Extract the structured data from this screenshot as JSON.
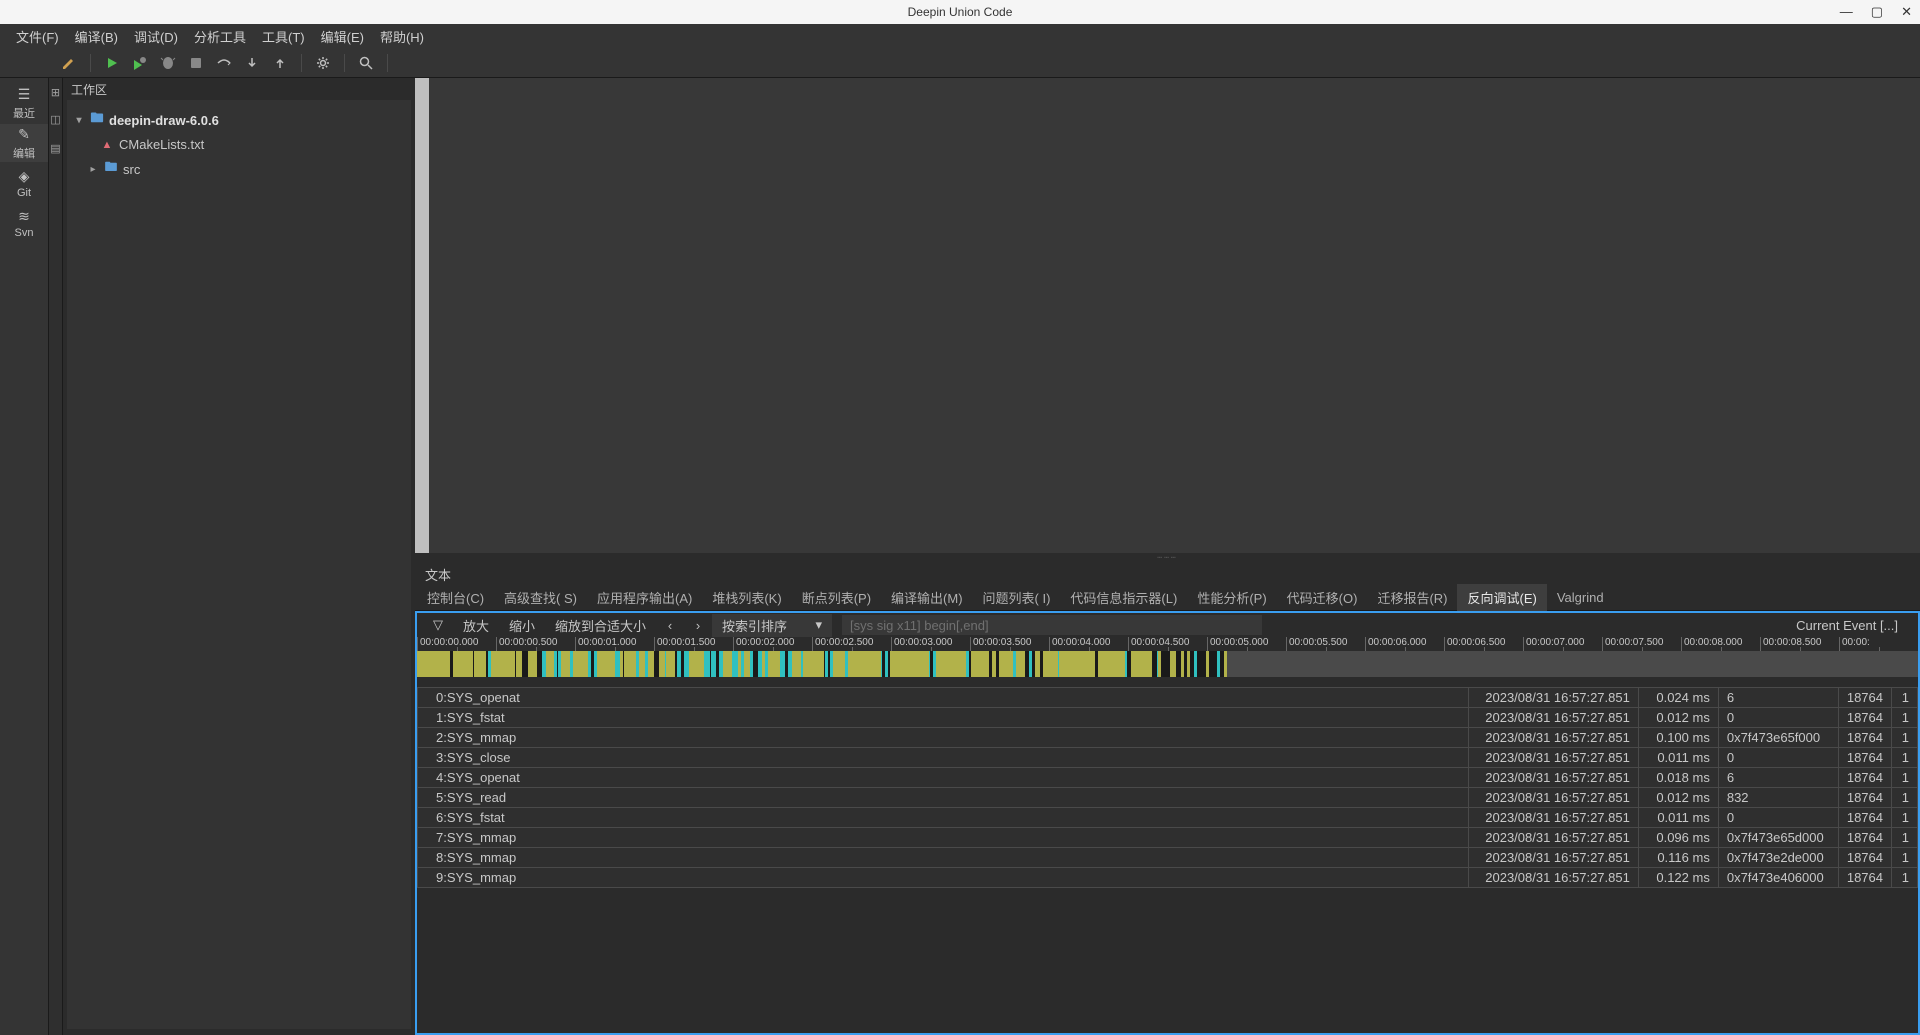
{
  "title": "Deepin Union Code",
  "menubar": [
    "文件(F)",
    "编译(B)",
    "调试(D)",
    "分析工具",
    "工具(T)",
    "编辑(E)",
    "帮助(H)"
  ],
  "sidebar": {
    "items": [
      {
        "label": "最近",
        "icon": "☰"
      },
      {
        "label": "编辑",
        "icon": "✎",
        "active": true
      },
      {
        "label": "Git",
        "icon": "◈"
      },
      {
        "label": "Svn",
        "icon": "≋"
      }
    ]
  },
  "workspace": {
    "title": "工作区",
    "root": "deepin-draw-6.0.6",
    "files": [
      {
        "name": "CMakeLists.txt",
        "icon": "▲",
        "type": "file"
      },
      {
        "name": "src",
        "icon": "folder",
        "type": "folder"
      }
    ]
  },
  "bottom_label": "文本",
  "bottom_tabs": [
    {
      "label": "控制台(C)"
    },
    {
      "label": "高级查找( S)"
    },
    {
      "label": "应用程序输出(A)"
    },
    {
      "label": "堆栈列表(K)"
    },
    {
      "label": "断点列表(P)"
    },
    {
      "label": "编译输出(M)"
    },
    {
      "label": "问题列表( I)"
    },
    {
      "label": "代码信息指示器(L)"
    },
    {
      "label": "性能分析(P)"
    },
    {
      "label": "代码迁移(O)"
    },
    {
      "label": "迁移报告(R)"
    },
    {
      "label": "反向调试(E)",
      "active": true
    },
    {
      "label": "Valgrind"
    }
  ],
  "rdebug": {
    "tools": [
      "放大",
      "缩小",
      "缩放到合适大小"
    ],
    "sort": "按索引排序",
    "search_placeholder": "[sys sig x11] begin[,end]",
    "current_label": "Current Event [...]",
    "filter_icon": "▽"
  },
  "timeline_ticks": [
    "00:00:00.000",
    "00:00:00.500",
    "00:00:01.000",
    "00:00:01.500",
    "00:00:02.000",
    "00:00:02.500",
    "00:00:03.000",
    "00:00:03.500",
    "00:00:04.000",
    "00:00:04.500",
    "00:00:05.000",
    "00:00:05.500",
    "00:00:06.000",
    "00:00:06.500",
    "00:00:07.000",
    "00:00:07.500",
    "00:00:08.000",
    "00:00:08.500",
    "00:00:"
  ],
  "events": [
    {
      "name": "0:SYS_openat",
      "time": "2023/08/31 16:57:27.851",
      "dur": "0.024 ms",
      "ret": "6",
      "pid": "18764",
      "n": "1"
    },
    {
      "name": "1:SYS_fstat",
      "time": "2023/08/31 16:57:27.851",
      "dur": "0.012 ms",
      "ret": "0",
      "pid": "18764",
      "n": "1"
    },
    {
      "name": "2:SYS_mmap",
      "time": "2023/08/31 16:57:27.851",
      "dur": "0.100 ms",
      "ret": "0x7f473e65f000",
      "pid": "18764",
      "n": "1"
    },
    {
      "name": "3:SYS_close",
      "time": "2023/08/31 16:57:27.851",
      "dur": "0.011 ms",
      "ret": "0",
      "pid": "18764",
      "n": "1"
    },
    {
      "name": "4:SYS_openat",
      "time": "2023/08/31 16:57:27.851",
      "dur": "0.018 ms",
      "ret": "6",
      "pid": "18764",
      "n": "1"
    },
    {
      "name": "5:SYS_read",
      "time": "2023/08/31 16:57:27.851",
      "dur": "0.012 ms",
      "ret": "832",
      "pid": "18764",
      "n": "1"
    },
    {
      "name": "6:SYS_fstat",
      "time": "2023/08/31 16:57:27.851",
      "dur": "0.011 ms",
      "ret": "0",
      "pid": "18764",
      "n": "1"
    },
    {
      "name": "7:SYS_mmap",
      "time": "2023/08/31 16:57:27.851",
      "dur": "0.096 ms",
      "ret": "0x7f473e65d000",
      "pid": "18764",
      "n": "1"
    },
    {
      "name": "8:SYS_mmap",
      "time": "2023/08/31 16:57:27.851",
      "dur": "0.116 ms",
      "ret": "0x7f473e2de000",
      "pid": "18764",
      "n": "1"
    },
    {
      "name": "9:SYS_mmap",
      "time": "2023/08/31 16:57:27.851",
      "dur": "0.122 ms",
      "ret": "0x7f473e406000",
      "pid": "18764",
      "n": "1"
    }
  ],
  "timeline_segments": [
    {
      "w": 2.2,
      "c": "#b2b24a"
    },
    {
      "w": 0.2,
      "c": "#1a1a1a"
    },
    {
      "w": 1.3,
      "c": "#b2b24a"
    },
    {
      "w": 0.1,
      "c": "#1a1a1a"
    },
    {
      "w": 0.8,
      "c": "#b2b24a"
    },
    {
      "w": 0.1,
      "c": "#1a1a1a"
    },
    {
      "w": 0.2,
      "c": "#30c0c0"
    },
    {
      "w": 1.6,
      "c": "#b2b24a"
    },
    {
      "w": 0.1,
      "c": "#1a1a1a"
    },
    {
      "w": 0.4,
      "c": "#b2b24a"
    },
    {
      "w": 0.4,
      "c": "#1a1a1a"
    },
    {
      "w": 0.6,
      "c": "#b2b24a"
    },
    {
      "w": 0.3,
      "c": "#1a1a1a"
    },
    {
      "w": 0.3,
      "c": "#30c0c0"
    },
    {
      "w": 0.5,
      "c": "#b2b24a"
    },
    {
      "w": 0.2,
      "c": "#30c0c0"
    },
    {
      "w": 0.1,
      "c": "#1a1a1a"
    },
    {
      "w": 0.2,
      "c": "#30c0c0"
    },
    {
      "w": 0.6,
      "c": "#b2b24a"
    },
    {
      "w": 0.2,
      "c": "#30c0c0"
    },
    {
      "w": 1.0,
      "c": "#b2b24a"
    },
    {
      "w": 0.2,
      "c": "#30c0c0"
    },
    {
      "w": 0.2,
      "c": "#1a1a1a"
    },
    {
      "w": 0.2,
      "c": "#30c0c0"
    },
    {
      "w": 1.2,
      "c": "#b2b24a"
    },
    {
      "w": 0.3,
      "c": "#30c0c0"
    },
    {
      "w": 0.2,
      "c": "#b2b24a"
    },
    {
      "w": 0.1,
      "c": "#1a1a1a"
    },
    {
      "w": 0.8,
      "c": "#b2b24a"
    },
    {
      "w": 0.2,
      "c": "#30c0c0"
    },
    {
      "w": 0.4,
      "c": "#b2b24a"
    },
    {
      "w": 0.2,
      "c": "#30c0c0"
    },
    {
      "w": 0.4,
      "c": "#b2b24a"
    },
    {
      "w": 0.3,
      "c": "#1a1a1a"
    },
    {
      "w": 0.4,
      "c": "#b2b24a"
    },
    {
      "w": 0.1,
      "c": "#30c0c0"
    },
    {
      "w": 0.6,
      "c": "#b2b24a"
    },
    {
      "w": 0.1,
      "c": "#1a1a1a"
    },
    {
      "w": 0.3,
      "c": "#30c0c0"
    },
    {
      "w": 0.2,
      "c": "#1a1a1a"
    },
    {
      "w": 0.3,
      "c": "#30c0c0"
    },
    {
      "w": 1.0,
      "c": "#b2b24a"
    },
    {
      "w": 0.4,
      "c": "#30c0c0"
    },
    {
      "w": 0.1,
      "c": "#1a1a1a"
    },
    {
      "w": 0.3,
      "c": "#30c0c0"
    },
    {
      "w": 0.2,
      "c": "#1a1a1a"
    },
    {
      "w": 0.3,
      "c": "#30c0c0"
    },
    {
      "w": 0.6,
      "c": "#b2b24a"
    },
    {
      "w": 0.4,
      "c": "#30c0c0"
    },
    {
      "w": 0.2,
      "c": "#b2b24a"
    },
    {
      "w": 0.2,
      "c": "#30c0c0"
    },
    {
      "w": 0.4,
      "c": "#b2b24a"
    },
    {
      "w": 0.2,
      "c": "#30c0c0"
    },
    {
      "w": 0.3,
      "c": "#1a1a1a"
    },
    {
      "w": 0.3,
      "c": "#30c0c0"
    },
    {
      "w": 0.2,
      "c": "#b2b24a"
    },
    {
      "w": 0.2,
      "c": "#30c0c0"
    },
    {
      "w": 0.8,
      "c": "#b2b24a"
    },
    {
      "w": 0.3,
      "c": "#30c0c0"
    },
    {
      "w": 0.2,
      "c": "#1a1a1a"
    },
    {
      "w": 0.3,
      "c": "#30c0c0"
    },
    {
      "w": 0.6,
      "c": "#b2b24a"
    },
    {
      "w": 0.1,
      "c": "#30c0c0"
    },
    {
      "w": 1.4,
      "c": "#b2b24a"
    },
    {
      "w": 0.1,
      "c": "#1a1a1a"
    },
    {
      "w": 0.2,
      "c": "#30c0c0"
    },
    {
      "w": 0.1,
      "c": "#1a1a1a"
    },
    {
      "w": 0.2,
      "c": "#30c0c0"
    },
    {
      "w": 0.8,
      "c": "#b2b24a"
    },
    {
      "w": 0.2,
      "c": "#30c0c0"
    },
    {
      "w": 2.2,
      "c": "#b2b24a"
    },
    {
      "w": 0.1,
      "c": "#30c0c0"
    },
    {
      "w": 0.2,
      "c": "#1a1a1a"
    },
    {
      "w": 0.2,
      "c": "#30c0c0"
    },
    {
      "w": 0.1,
      "c": "#1a1a1a"
    },
    {
      "w": 2.6,
      "c": "#b2b24a"
    },
    {
      "w": 0.1,
      "c": "#30c0c0"
    },
    {
      "w": 0.2,
      "c": "#1a1a1a"
    },
    {
      "w": 0.2,
      "c": "#30c0c0"
    },
    {
      "w": 2.0,
      "c": "#b2b24a"
    },
    {
      "w": 0.2,
      "c": "#30c0c0"
    },
    {
      "w": 0.1,
      "c": "#1a1a1a"
    },
    {
      "w": 1.2,
      "c": "#b2b24a"
    },
    {
      "w": 0.2,
      "c": "#1a1a1a"
    },
    {
      "w": 0.3,
      "c": "#b2b24a"
    },
    {
      "w": 0.2,
      "c": "#1a1a1a"
    },
    {
      "w": 0.9,
      "c": "#b2b24a"
    },
    {
      "w": 0.2,
      "c": "#30c0c0"
    },
    {
      "w": 0.6,
      "c": "#b2b24a"
    },
    {
      "w": 0.3,
      "c": "#1a1a1a"
    },
    {
      "w": 0.2,
      "c": "#30c0c0"
    },
    {
      "w": 0.2,
      "c": "#1a1a1a"
    },
    {
      "w": 0.3,
      "c": "#b2b24a"
    },
    {
      "w": 0.2,
      "c": "#1a1a1a"
    },
    {
      "w": 1.0,
      "c": "#b2b24a"
    },
    {
      "w": 0.1,
      "c": "#30c0c0"
    },
    {
      "w": 2.4,
      "c": "#b2b24a"
    },
    {
      "w": 0.2,
      "c": "#1a1a1a"
    },
    {
      "w": 1.8,
      "c": "#b2b24a"
    },
    {
      "w": 0.1,
      "c": "#30c0c0"
    },
    {
      "w": 0.3,
      "c": "#1a1a1a"
    },
    {
      "w": 1.4,
      "c": "#b2b24a"
    },
    {
      "w": 0.3,
      "c": "#1a1a1a"
    },
    {
      "w": 0.1,
      "c": "#30c0c0"
    },
    {
      "w": 0.2,
      "c": "#b2b24a"
    },
    {
      "w": 0.6,
      "c": "#1a1a1a"
    },
    {
      "w": 0.4,
      "c": "#b2b24a"
    },
    {
      "w": 0.3,
      "c": "#1a1a1a"
    },
    {
      "w": 0.2,
      "c": "#b2b24a"
    },
    {
      "w": 0.2,
      "c": "#1a1a1a"
    },
    {
      "w": 0.2,
      "c": "#b2b24a"
    },
    {
      "w": 0.3,
      "c": "#1a1a1a"
    },
    {
      "w": 0.2,
      "c": "#30c0c0"
    },
    {
      "w": 0.6,
      "c": "#1a1a1a"
    },
    {
      "w": 0.2,
      "c": "#b2b24a"
    },
    {
      "w": 0.5,
      "c": "#1a1a1a"
    },
    {
      "w": 0.2,
      "c": "#30c0c0"
    },
    {
      "w": 0.3,
      "c": "#1a1a1a"
    },
    {
      "w": 0.2,
      "c": "#b2b24a"
    },
    {
      "w": 34,
      "c": "#4a4a4a"
    }
  ]
}
